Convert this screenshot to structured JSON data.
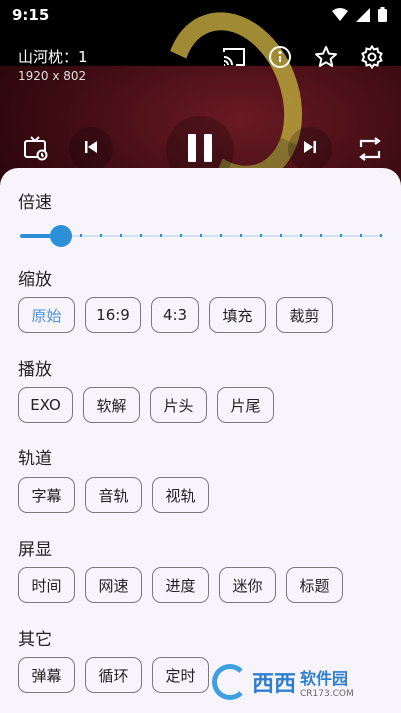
{
  "statusbar": {
    "time": "9:15"
  },
  "player": {
    "title": "山河枕：1",
    "resolution": "1920 x 802"
  },
  "sheet": {
    "speed": {
      "title": "倍速",
      "value_fraction": 0.115
    },
    "scale": {
      "title": "缩放",
      "options": [
        "原始",
        "16:9",
        "4:3",
        "填充",
        "裁剪"
      ],
      "selected": "原始"
    },
    "play": {
      "title": "播放",
      "options": [
        "EXO",
        "软解",
        "片头",
        "片尾"
      ]
    },
    "track": {
      "title": "轨道",
      "options": [
        "字幕",
        "音轨",
        "视轨"
      ]
    },
    "display": {
      "title": "屏显",
      "options": [
        "时间",
        "网速",
        "进度",
        "迷你",
        "标题"
      ]
    },
    "other": {
      "title": "其它",
      "options": [
        "弹幕",
        "循环",
        "定时"
      ]
    }
  },
  "watermark": {
    "brand": "西西",
    "name": "软件园",
    "url": "CR173.COM"
  },
  "colors": {
    "accent": "#2c8fd8",
    "selected_text": "#4a90d9",
    "sheet_bg": "#f8f4fb"
  }
}
